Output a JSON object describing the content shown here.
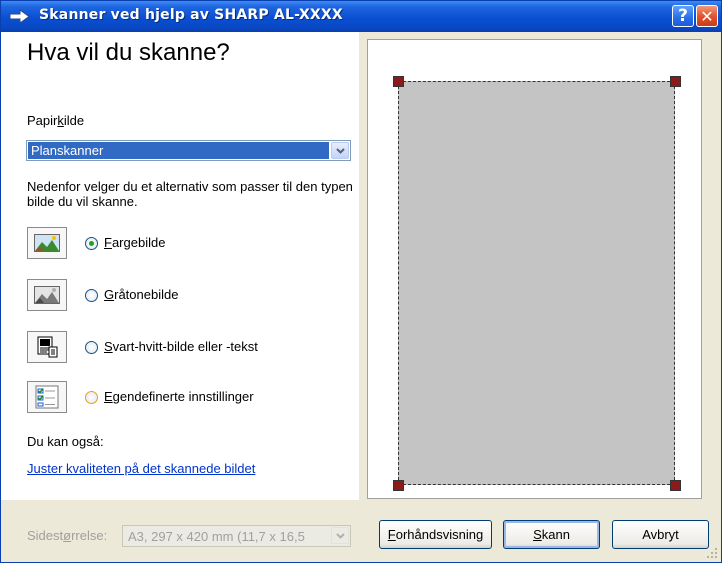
{
  "window": {
    "title": "Skanner ved hjelp av SHARP AL-XXXX",
    "help_button": "?",
    "close_button": "✕"
  },
  "main": {
    "heading": "Hva vil du skanne?",
    "paper_source": {
      "label_pre": "Papir",
      "label_key": "k",
      "label_post": "ilde",
      "value": "Planskanner"
    },
    "description": "Nedenfor velger du et alternativ som passer til den typen bilde du vil skanne.",
    "options": [
      {
        "pre": "",
        "key": "F",
        "post": "argebilde",
        "icon": "color-photo-icon",
        "selected": true
      },
      {
        "pre": "",
        "key": "G",
        "post": "råtonebilde",
        "icon": "grayscale-photo-icon",
        "selected": false
      },
      {
        "pre": "",
        "key": "S",
        "post": "vart-hvitt-bilde eller -tekst",
        "icon": "black-white-text-icon",
        "selected": false
      },
      {
        "pre": "",
        "key": "E",
        "post": "gendefinerte innstillinger",
        "icon": "custom-settings-icon",
        "selected": false
      }
    ],
    "also_label": "Du kan også:",
    "adjust_link": "Juster kvaliteten på det skannede bildet"
  },
  "footer": {
    "size_label_pre": "Sidest",
    "size_label_key": "ø",
    "size_label_post": "rrelse:",
    "size_value": "A3, 297 x 420 mm (11,7 x 16,5",
    "preview_pre": "",
    "preview_key": "F",
    "preview_post": "orhåndsvisning",
    "scan_pre": "",
    "scan_key": "S",
    "scan_post": "kann",
    "cancel": "Avbryt"
  },
  "colors": {
    "titlebar": "#0a4fd3",
    "selection": "#316ac5",
    "link": "#0033cc",
    "preview_area": "#c4c4c4",
    "crop_handle": "#8b1a1a"
  }
}
